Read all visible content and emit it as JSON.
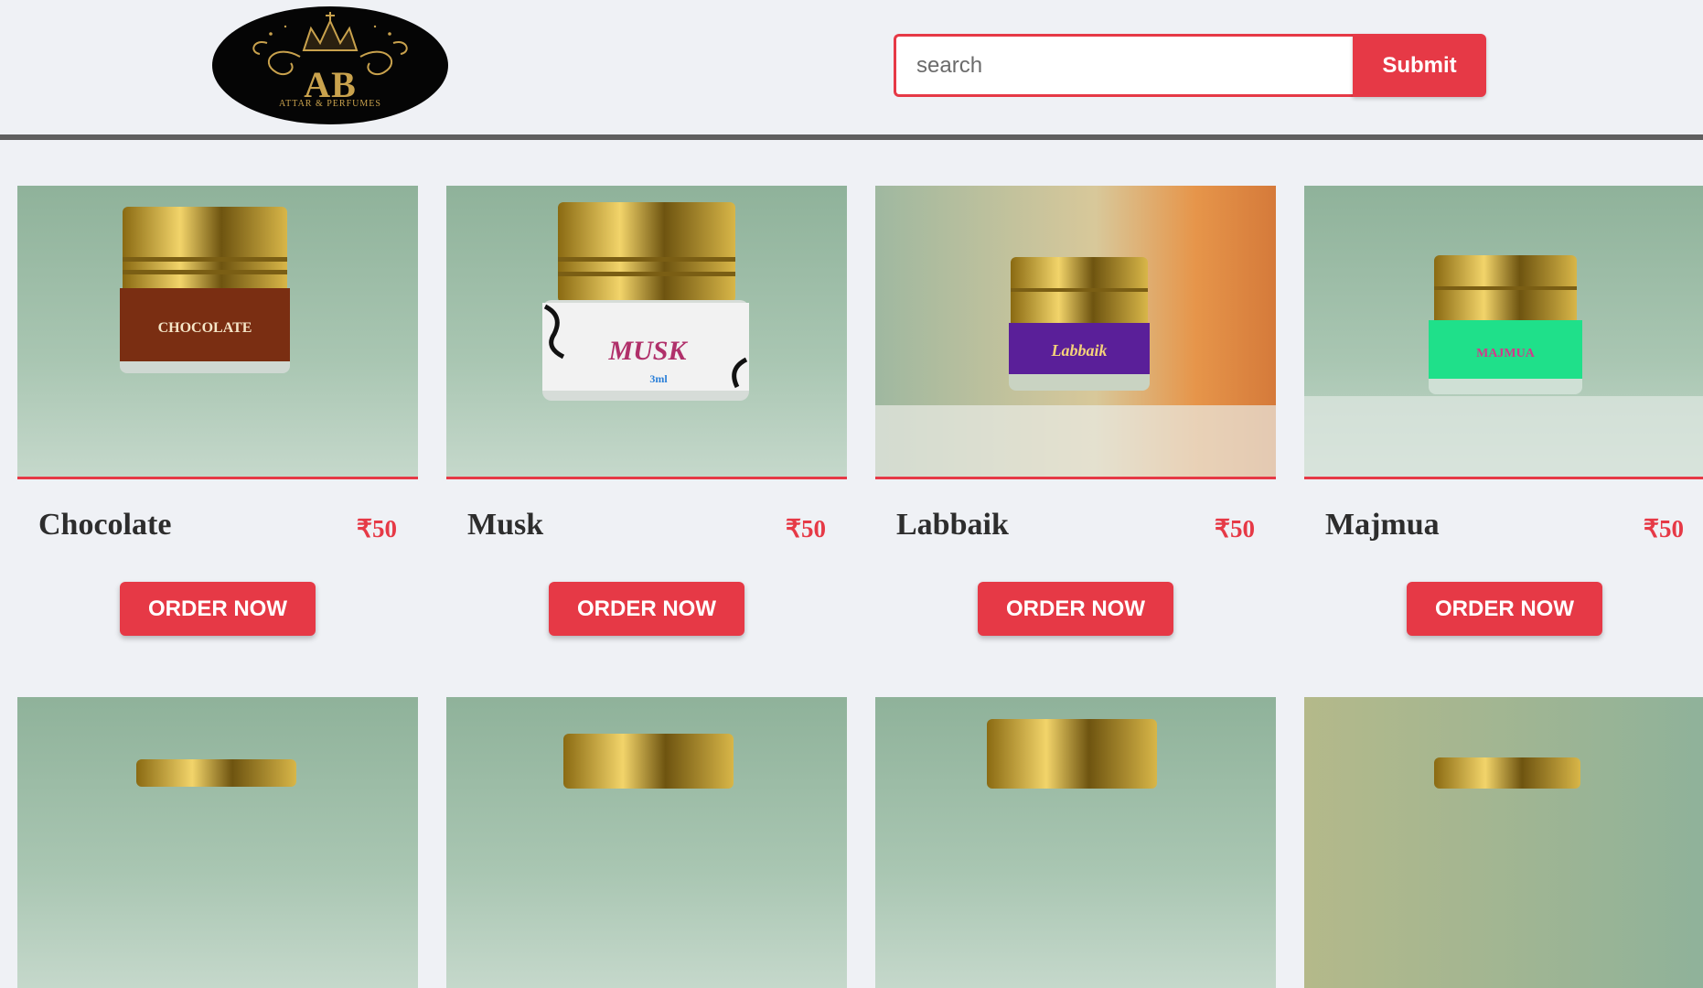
{
  "brand": {
    "logo_main": "AB",
    "logo_sub": "ATTAR & PERFUMES"
  },
  "search": {
    "placeholder": "search",
    "value": "",
    "submit_label": "Submit"
  },
  "colors": {
    "accent": "#e63946",
    "background": "#eff1f5",
    "divider": "#5f5f5f"
  },
  "products": [
    {
      "name": "Chocolate",
      "price": "₹50",
      "order_label": "ORDER NOW",
      "label_text": "CHOCOLATE",
      "label_color": "#7a2e12"
    },
    {
      "name": "Musk",
      "price": "₹50",
      "order_label": "ORDER NOW",
      "label_text": "MUSK",
      "label_color": "#f2f2f2"
    },
    {
      "name": "Labbaik",
      "price": "₹50",
      "order_label": "ORDER NOW",
      "label_text": "Labbaik",
      "label_color": "#5a1f99"
    },
    {
      "name": "Majmua",
      "price": "₹50",
      "order_label": "ORDER NOW",
      "label_text": "MAJMUA",
      "label_color": "#1fe08a"
    }
  ]
}
